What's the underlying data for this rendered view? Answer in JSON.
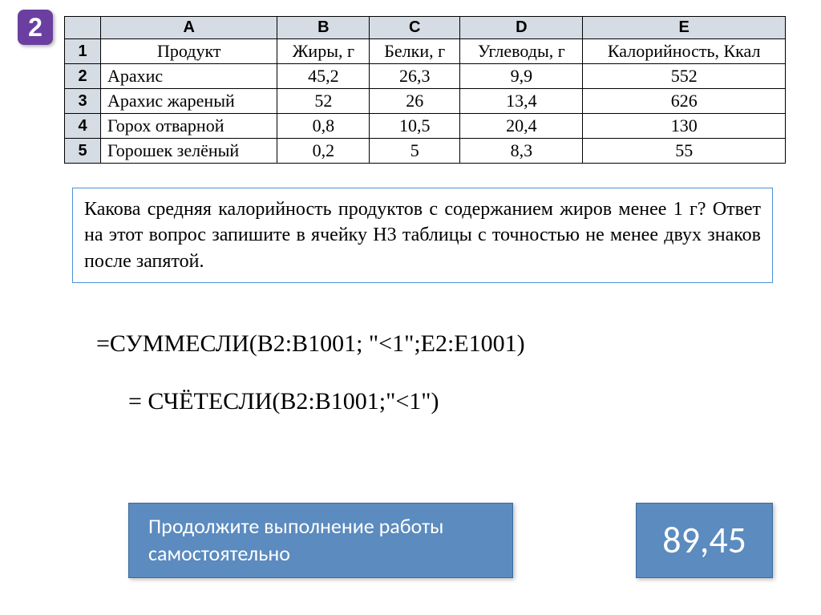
{
  "badge": "2",
  "table": {
    "columns": [
      "A",
      "B",
      "C",
      "D",
      "E"
    ],
    "header_row": [
      "1",
      "Продукт",
      "Жиры, г",
      "Белки, г",
      "Углеводы, г",
      "Калорийность, Ккал"
    ],
    "rows": [
      [
        "2",
        "Арахис",
        "45,2",
        "26,3",
        "9,9",
        "552"
      ],
      [
        "3",
        "Арахис жареный",
        "52",
        "26",
        "13,4",
        "626"
      ],
      [
        "4",
        "Горох отварной",
        "0,8",
        "10,5",
        "20,4",
        "130"
      ],
      [
        "5",
        "Горошек зелёный",
        "0,2",
        "5",
        "8,3",
        "55"
      ]
    ]
  },
  "question": "Какова средняя калорийность продуктов с содержанием жиров менее 1 г? Ответ на этот вопрос запишите в ячейку H3 таблицы с точностью не менее двух знаков после запятой.",
  "formula1": "=СУММЕСЛИ(B2:B1001; \"<1\";E2:E1001)",
  "formula2": "= СЧЁТЕСЛИ(B2:B1001;\"<1\")",
  "continue_label": "Продолжите выполнение работы самостоятельно",
  "answer": "89,45",
  "chart_data": {
    "type": "table",
    "columns": [
      "Продукт",
      "Жиры, г",
      "Белки, г",
      "Углеводы, г",
      "Калорийность, Ккал"
    ],
    "rows": [
      [
        "Арахис",
        45.2,
        26.3,
        9.9,
        552
      ],
      [
        "Арахис жареный",
        52,
        26,
        13.4,
        626
      ],
      [
        "Горох отварной",
        0.8,
        10.5,
        20.4,
        130
      ],
      [
        "Горошек зелёный",
        0.2,
        5,
        8.3,
        55
      ]
    ]
  }
}
